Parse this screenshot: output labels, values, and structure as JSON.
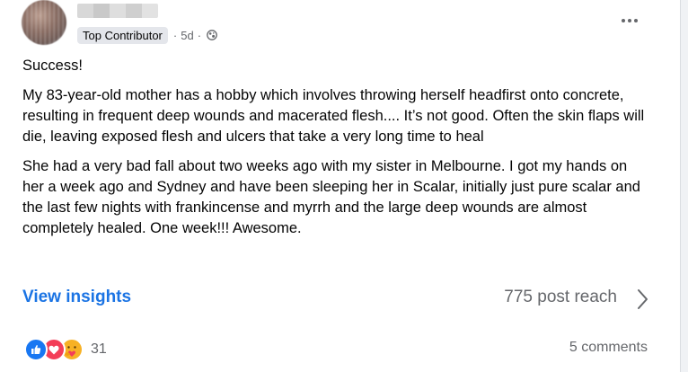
{
  "author": {
    "badge": "Top Contributor",
    "time": "5d"
  },
  "post": {
    "paragraphs": [
      "Success!",
      "My 83-year-old mother has a hobby which involves throwing herself headfirst onto concrete, resulting in frequent deep wounds and macerated flesh.... It’s not good. Often the skin flaps will die, leaving exposed flesh and ulcers that take a very long time to heal",
      "She had a very bad fall about two weeks ago with my sister in Melbourne. I got my hands on her a week ago and Sydney and have been sleeping her in Scalar, initially just pure scalar and the last few nights with frankincense and myrrh and the large deep wounds are almost completely healed. One week!!! Awesome."
    ]
  },
  "insights": {
    "link_label": "View insights",
    "reach_label": "775 post reach"
  },
  "footer": {
    "reaction_count": "31",
    "comments_label": "5 comments"
  },
  "icons": {
    "audience": "globe-icon",
    "menu": "more-horizontal-icon",
    "reactions": [
      "like-icon",
      "love-icon",
      "care-icon"
    ]
  },
  "colors": {
    "link": "#1b74e4",
    "muted": "#65676b",
    "like": "#1877f2",
    "love": "#f33e58",
    "care": "#f7b125"
  }
}
